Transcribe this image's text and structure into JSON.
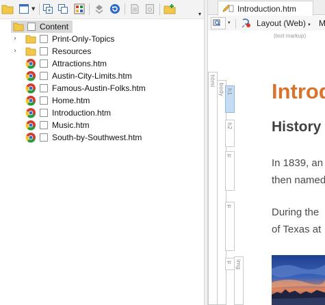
{
  "left_toolbar": {
    "buttons": [
      "open-folder-icon",
      "page-icon",
      "copy-icon",
      "duplicate-icon",
      "grid-color-icon",
      "sync-icon",
      "refresh-icon",
      "document-icon",
      "pages-icon",
      "add-folder-icon"
    ],
    "menu_arrow": "▾"
  },
  "tree": {
    "items": [
      {
        "label": "Content",
        "type": "folder",
        "expander": "",
        "selected": true
      },
      {
        "label": "Print-Only-Topics",
        "type": "folder",
        "expander": "›"
      },
      {
        "label": "Resources",
        "type": "folder",
        "expander": "›"
      },
      {
        "label": "Attractions.htm",
        "type": "topic"
      },
      {
        "label": "Austin-City-Limits.htm",
        "type": "topic"
      },
      {
        "label": "Famous-Austin-Folks.htm",
        "type": "topic"
      },
      {
        "label": "Home.htm",
        "type": "topic"
      },
      {
        "label": "Introduction.htm",
        "type": "topic"
      },
      {
        "label": "Music.htm",
        "type": "topic"
      },
      {
        "label": "South-by-Southwest.htm",
        "type": "topic"
      }
    ]
  },
  "editor": {
    "tab_title": "Introduction.htm",
    "layout_label": "Layout (Web)",
    "layout_caret": "▾",
    "zoom_caret": "▾",
    "overflow_label": "M",
    "markup_hint": "(text markup)",
    "structure_bars": [
      "html",
      "body",
      "h1",
      "h2",
      "p",
      "p",
      "p",
      "img"
    ],
    "heading1": "Introd",
    "heading2": "History",
    "para1_line1": "In 1839, an",
    "para1_line2": "then named",
    "para2_line1": "During the",
    "para2_line2": "of Texas at"
  },
  "colors": {
    "heading1": "#d8742c",
    "selection": "#d9d9d9",
    "folder": "#f2c84b"
  }
}
